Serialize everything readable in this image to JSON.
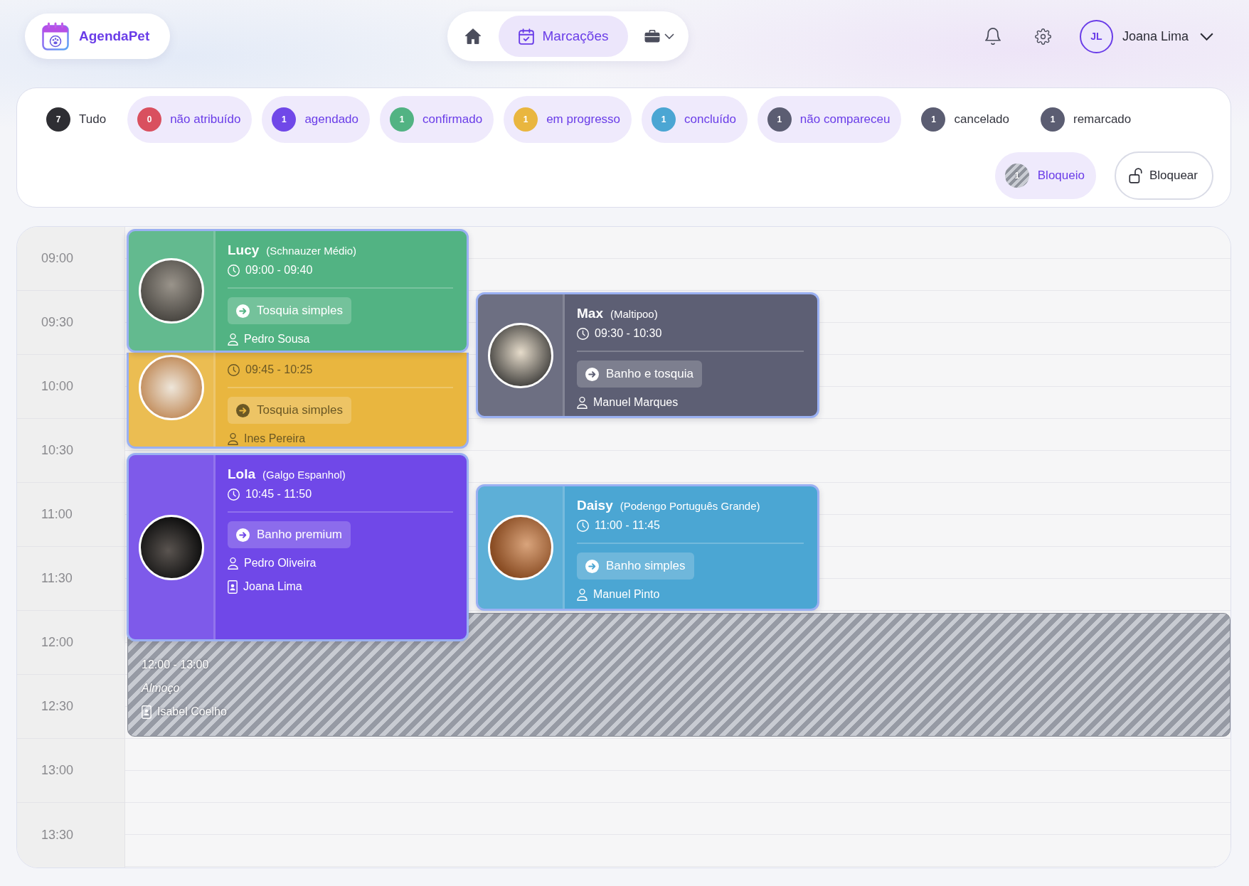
{
  "app": {
    "name": "AgendaPet"
  },
  "nav": [
    {
      "kind": "home",
      "selected": false
    },
    {
      "kind": "calendar",
      "label": "Marcações",
      "selected": true
    },
    {
      "kind": "briefcase",
      "selected": false
    }
  ],
  "user": {
    "initials": "JL",
    "name": "Joana Lima"
  },
  "filters": [
    {
      "label": "Tudo",
      "count": "7",
      "color": "#2e2e33",
      "selected": false
    },
    {
      "label": "não atribuído",
      "count": "0",
      "color": "#d9505f",
      "selected": true
    },
    {
      "label": "agendado",
      "count": "1",
      "color": "#7048e8",
      "selected": true
    },
    {
      "label": "confirmado",
      "count": "1",
      "color": "#52b383",
      "selected": true
    },
    {
      "label": "em progresso",
      "count": "1",
      "color": "#e9b63f",
      "selected": true
    },
    {
      "label": "concluído",
      "count": "1",
      "color": "#4ba6d3",
      "selected": true
    },
    {
      "label": "não compareceu",
      "count": "1",
      "color": "#5b5d72",
      "selected": true
    },
    {
      "label": "cancelado",
      "count": "1",
      "color": "#5b5d72",
      "selected": false
    },
    {
      "label": "remarcado",
      "count": "1",
      "color": "#5b5d72",
      "selected": false
    }
  ],
  "block_filter": {
    "label": "Bloqueio",
    "count": "1",
    "selected": true
  },
  "block_button": {
    "label": "Bloquear"
  },
  "time_slots": [
    "09:00",
    "09:30",
    "10:00",
    "10:30",
    "11:00",
    "11:30",
    "12:00",
    "12:30",
    "13:00",
    "13:30"
  ],
  "events": [
    {
      "kind": "appointment",
      "name": "Lucy",
      "breed": "(Schnauzer Médio)",
      "time": "09:00 - 09:40",
      "service": "Tosquia simples",
      "people": [
        {
          "kind": "person",
          "name": "Pedro Sousa"
        }
      ],
      "color": "#52b383"
    },
    {
      "kind": "appointment",
      "name": "Max",
      "breed": "(Maltipoo)",
      "time": "09:30 - 10:30",
      "service": "Banho e tosquia",
      "people": [
        {
          "kind": "person",
          "name": "Manuel Marques"
        }
      ],
      "color": "#5d5f74"
    },
    {
      "kind": "appointment",
      "time": "09:45 - 10:25",
      "service": "Tosquia simples",
      "people": [
        {
          "kind": "person",
          "name": "Ines Pereira"
        }
      ],
      "color": "#e9b63f"
    },
    {
      "kind": "appointment",
      "name": "Lola",
      "breed": "(Galgo Espanhol)",
      "time": "10:45 - 11:50",
      "service": "Banho premium",
      "people": [
        {
          "kind": "person",
          "name": "Pedro Oliveira"
        },
        {
          "kind": "badge",
          "name": "Joana Lima"
        }
      ],
      "color": "#7048e8"
    },
    {
      "kind": "appointment",
      "name": "Daisy",
      "breed": "(Podengo Português Grande)",
      "time": "11:00 - 11:45",
      "service": "Banho simples",
      "people": [
        {
          "kind": "person",
          "name": "Manuel Pinto"
        }
      ],
      "color": "#4ba6d3"
    },
    {
      "kind": "block",
      "time": "12:00 - 13:00",
      "note": "Almoço",
      "people": [
        {
          "kind": "badge",
          "name": "Isabel Coelho"
        }
      ]
    }
  ]
}
